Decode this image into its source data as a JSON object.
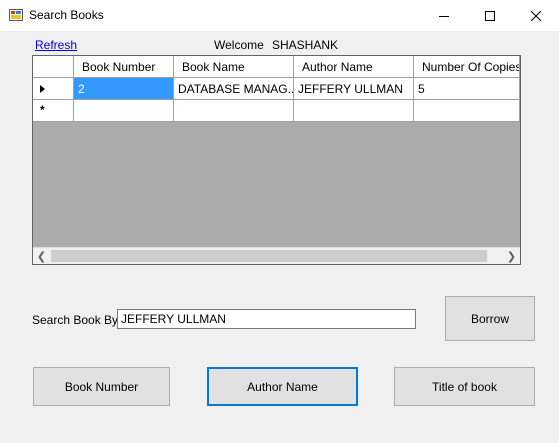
{
  "window": {
    "title": "Search Books",
    "icon": "form-icon"
  },
  "header": {
    "refresh_label": "Refresh",
    "welcome_label": "Welcome",
    "user_name": "SHASHANK"
  },
  "grid": {
    "columns": [
      "Book Number",
      "Book Name",
      "Author Name",
      "Number Of Copies"
    ],
    "rows": [
      [
        "2",
        "DATABASE MANAG...",
        "JEFFERY ULLMAN",
        "5"
      ]
    ],
    "new_row_marker": "*"
  },
  "search": {
    "label": "Search Book By",
    "value": "JEFFERY ULLMAN"
  },
  "buttons": {
    "borrow": "Borrow",
    "book_number": "Book Number",
    "author_name": "Author Name",
    "title_of_book": "Title of book"
  },
  "colors": {
    "selection": "#3399ff",
    "grid_background": "#ababab",
    "focus_border": "#0078d7",
    "link": "#0000ee"
  }
}
